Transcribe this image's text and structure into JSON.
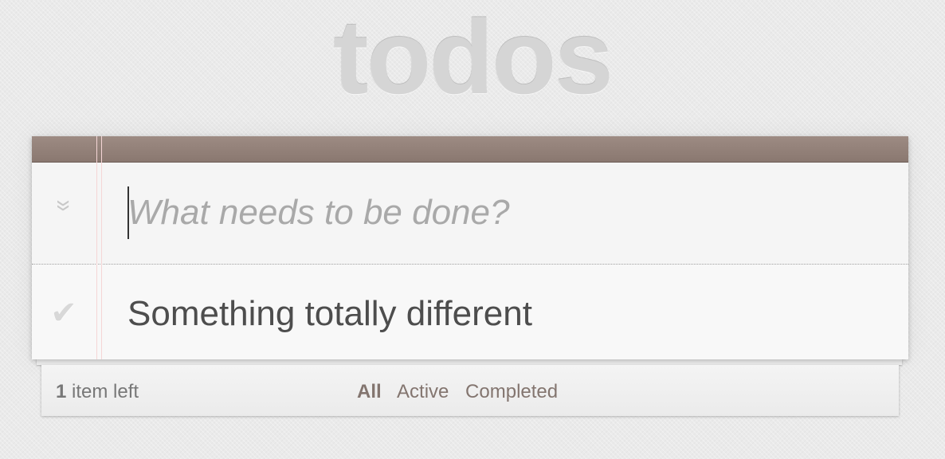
{
  "app": {
    "title": "todos"
  },
  "new_todo": {
    "placeholder": "What needs to be done?",
    "value": ""
  },
  "toggle_all": {
    "icon": "double-chevron-down-icon",
    "glyph": "»"
  },
  "todos": [
    {
      "label": "Something totally different",
      "completed": false,
      "check_glyph": "✔"
    }
  ],
  "footer": {
    "count_number": "1",
    "count_text": " item left",
    "filters": {
      "all": "All",
      "active": "Active",
      "completed": "Completed"
    },
    "selected_filter": "All"
  },
  "colors": {
    "header_bar": "#8d7b73",
    "filter_link": "#83756f",
    "text": "#4d4d4d",
    "margin_line": "#f5d6d6"
  }
}
